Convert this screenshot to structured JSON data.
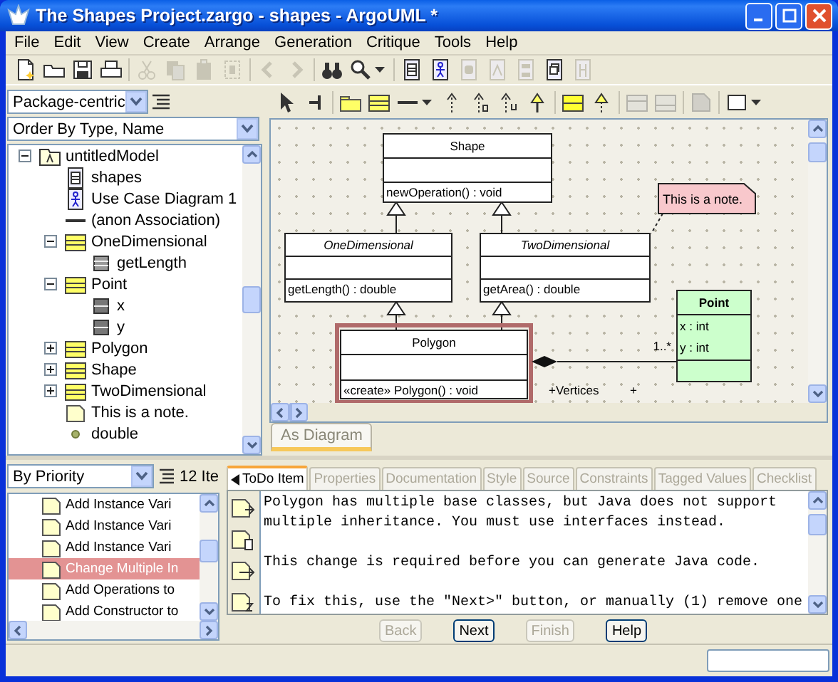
{
  "window": {
    "title": "The Shapes Project.zargo - shapes - ArgoUML *"
  },
  "menu": [
    "File",
    "Edit",
    "View",
    "Create",
    "Arrange",
    "Generation",
    "Critique",
    "Tools",
    "Help"
  ],
  "toolbar": [
    [
      {
        "kind": "new",
        "disabled": false
      },
      {
        "kind": "open",
        "disabled": false
      },
      {
        "kind": "save",
        "disabled": false
      },
      {
        "kind": "print",
        "disabled": false
      }
    ],
    [
      {
        "kind": "cut",
        "disabled": true
      },
      {
        "kind": "copy",
        "disabled": true
      },
      {
        "kind": "paste",
        "disabled": true
      },
      {
        "kind": "delete",
        "disabled": true
      }
    ],
    [
      {
        "kind": "back",
        "disabled": true
      },
      {
        "kind": "forward",
        "disabled": true
      }
    ],
    [
      {
        "kind": "find",
        "disabled": false
      },
      {
        "kind": "zoom",
        "disabled": false
      }
    ],
    [
      {
        "kind": "class-diagram",
        "disabled": false
      },
      {
        "kind": "usecase-diagram",
        "disabled": false
      },
      {
        "kind": "state-diagram",
        "disabled": true
      },
      {
        "kind": "activity-diagram",
        "disabled": true
      },
      {
        "kind": "collaboration-diagram",
        "disabled": true
      },
      {
        "kind": "deployment-diagram",
        "disabled": false
      },
      {
        "kind": "sequence-diagram",
        "disabled": true
      }
    ]
  ],
  "explorer": {
    "perspective": "Package-centric",
    "order": "Order By Type, Name",
    "tree": [
      {
        "label": "untitledModel",
        "kind": "model",
        "expanded": true,
        "children": [
          {
            "label": "shapes",
            "kind": "class-diagram"
          },
          {
            "label": "Use Case Diagram 1",
            "kind": "usecase-diagram"
          },
          {
            "label": "(anon Association)",
            "kind": "association"
          },
          {
            "label": "OneDimensional",
            "kind": "class",
            "expanded": true,
            "children": [
              {
                "label": "getLength",
                "kind": "operation"
              }
            ]
          },
          {
            "label": "Point",
            "kind": "class",
            "expanded": true,
            "children": [
              {
                "label": "x",
                "kind": "attribute"
              },
              {
                "label": "y",
                "kind": "attribute"
              }
            ]
          },
          {
            "label": "Polygon",
            "kind": "class",
            "expanded": false
          },
          {
            "label": "Shape",
            "kind": "class",
            "expanded": false
          },
          {
            "label": "TwoDimensional",
            "kind": "class",
            "expanded": false
          },
          {
            "label": "This is a note.",
            "kind": "note"
          },
          {
            "label": "double",
            "kind": "datatype"
          }
        ]
      }
    ]
  },
  "diagram_tools": [
    [
      {
        "kind": "select",
        "disabled": false
      },
      {
        "kind": "broom",
        "disabled": false
      }
    ],
    [
      {
        "kind": "package",
        "disabled": false
      },
      {
        "kind": "class",
        "disabled": false
      },
      {
        "kind": "association",
        "disabled": false
      },
      {
        "kind": "dependency",
        "disabled": false
      },
      {
        "kind": "permission",
        "disabled": false
      },
      {
        "kind": "usage",
        "disabled": false
      },
      {
        "kind": "generalization",
        "disabled": false
      }
    ],
    [
      {
        "kind": "interface",
        "disabled": false
      },
      {
        "kind": "realization",
        "disabled": false
      }
    ],
    [
      {
        "kind": "attribute",
        "disabled": true
      },
      {
        "kind": "operation",
        "disabled": true
      }
    ],
    [
      {
        "kind": "note",
        "disabled": true
      }
    ],
    [
      {
        "kind": "rectangle",
        "disabled": false
      }
    ]
  ],
  "diagram": {
    "classes": [
      {
        "name": "Shape",
        "abstract": false,
        "operations": [
          "newOperation() : void"
        ],
        "color": "#ffffff",
        "selected": false
      },
      {
        "name": "OneDimensional",
        "abstract": true,
        "operations": [
          "getLength() : double"
        ],
        "color": "#ffffff",
        "selected": false
      },
      {
        "name": "TwoDimensional",
        "abstract": true,
        "operations": [
          "getArea() : double"
        ],
        "color": "#ffffff",
        "selected": false
      },
      {
        "name": "Polygon",
        "abstract": false,
        "operations": [
          "«create» Polygon() : void"
        ],
        "color": "#ffffff",
        "selected": true
      },
      {
        "name": "Point",
        "abstract": false,
        "attributes": [
          "x : int",
          "y : int"
        ],
        "color": "#ccffcc",
        "selected": false
      }
    ],
    "note": "This is a note.",
    "association": {
      "multiplicity": "1..*",
      "role": "+Vertices",
      "other_role": "+"
    },
    "tab": "As Diagram"
  },
  "todo": {
    "sort": "By Priority",
    "count": "12 Ite",
    "items": [
      {
        "text": "Add Instance Vari",
        "selected": false
      },
      {
        "text": "Add Instance Vari",
        "selected": false
      },
      {
        "text": "Add Instance Vari",
        "selected": false
      },
      {
        "text": "Change Multiple In",
        "selected": true
      },
      {
        "text": "Add Operations to",
        "selected": false
      },
      {
        "text": "Add Constructor to",
        "selected": false
      }
    ]
  },
  "details": {
    "tabs": [
      {
        "label": "ToDo Item",
        "selected": true,
        "disabled": false
      },
      {
        "label": "Properties",
        "selected": false,
        "disabled": true
      },
      {
        "label": "Documentation",
        "selected": false,
        "disabled": true
      },
      {
        "label": "Style",
        "selected": false,
        "disabled": true
      },
      {
        "label": "Source",
        "selected": false,
        "disabled": true
      },
      {
        "label": "Constraints",
        "selected": false,
        "disabled": true
      },
      {
        "label": "Tagged Values",
        "selected": false,
        "disabled": true
      },
      {
        "label": "Checklist",
        "selected": false,
        "disabled": true
      }
    ],
    "paragraphs": [
      "Polygon has multiple base classes, but Java does not support multiple inheritance.  You must use interfaces instead.",
      "This change is required before you can generate Java code.",
      "To fix this, use the \"Next>\" button, or manually (1) remove one"
    ],
    "buttons": [
      {
        "label": "Back",
        "disabled": true
      },
      {
        "label": "Next",
        "disabled": false
      },
      {
        "label": "Finish",
        "disabled": true
      },
      {
        "label": "Help",
        "disabled": false
      }
    ]
  }
}
